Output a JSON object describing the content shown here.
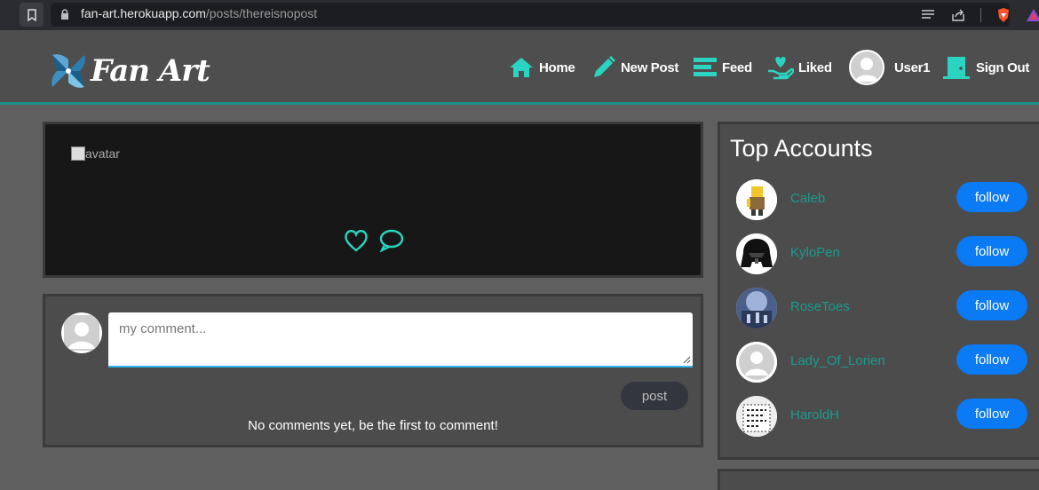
{
  "browser": {
    "url_domain": "fan-art.herokuapp.com",
    "url_path": "/posts/thereisnopost"
  },
  "nav": {
    "brand": "Fan Art",
    "items": [
      {
        "label": "Home",
        "icon": "home-icon"
      },
      {
        "label": "New Post",
        "icon": "pencil-icon"
      },
      {
        "label": "Feed",
        "icon": "feed-icon"
      },
      {
        "label": "Liked",
        "icon": "liked-icon"
      },
      {
        "label": "User1",
        "icon": "avatar"
      },
      {
        "label": "Sign Out",
        "icon": "door-icon"
      }
    ]
  },
  "post": {
    "image_alt": "avatar"
  },
  "comment": {
    "placeholder": "my comment...",
    "post_label": "post",
    "empty_text": "No comments yet, be the first to comment!"
  },
  "sidebar": {
    "title": "Top Accounts",
    "accounts": [
      {
        "name": "Caleb",
        "button": "follow"
      },
      {
        "name": "KyloPen",
        "button": "follow"
      },
      {
        "name": "RoseToes",
        "button": "follow"
      },
      {
        "name": "Lady_Of_Lorien",
        "button": "follow"
      },
      {
        "name": "HaroldH",
        "button": "follow"
      }
    ]
  },
  "colors": {
    "accent": "#2ad4c0",
    "link": "#1a9b8f",
    "follow_button": "#0a7af5",
    "page_bg": "#5f5f5f"
  }
}
